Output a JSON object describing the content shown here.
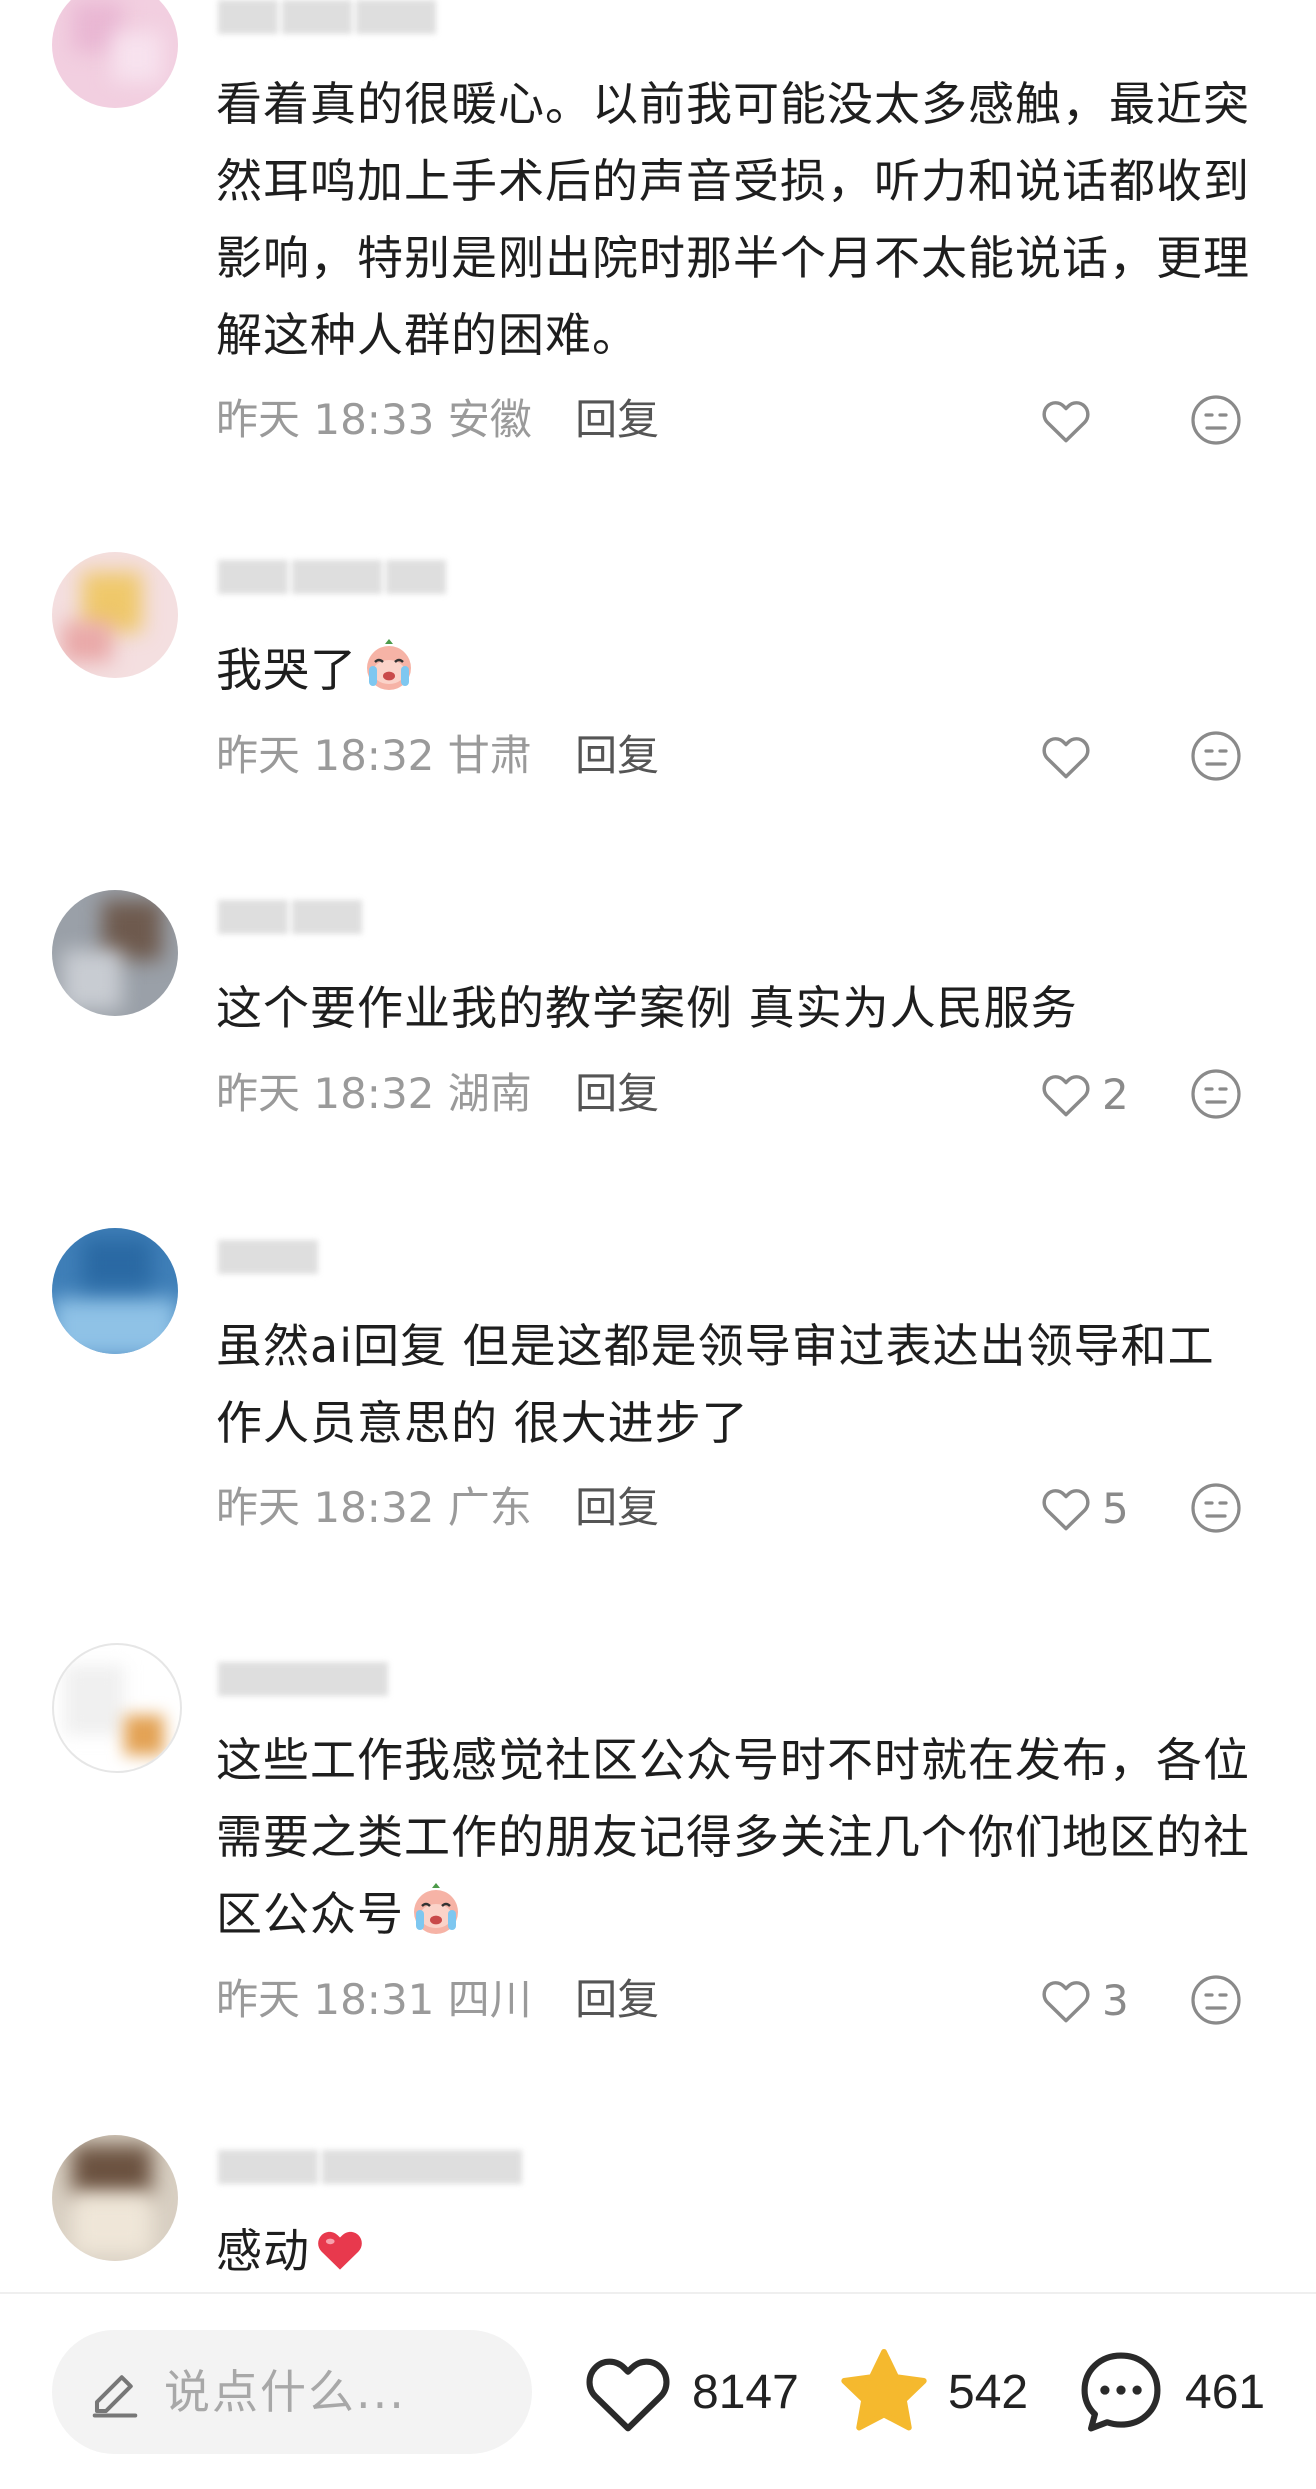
{
  "comments": [
    {
      "text": "看着真的很暖心。以前我可能没太多感触，最近突然耳鸣加上手术后的声音受损，听力和说话都收到影响，特别是刚出院时那半个月不太能说话，更理解这种人群的困难。",
      "time": "昨天 18:33",
      "location": "安徽",
      "reply": "回复",
      "likes": ""
    },
    {
      "text": "我哭了",
      "time": "昨天 18:32",
      "location": "甘肃",
      "reply": "回复",
      "likes": ""
    },
    {
      "text": "这个要作业我的教学案例 真实为人民服务",
      "time": "昨天 18:32",
      "location": "湖南",
      "reply": "回复",
      "likes": "2"
    },
    {
      "text": "虽然ai回复 但是这都是领导审过表达出领导和工作人员意思的 很大进步了",
      "time": "昨天 18:32",
      "location": "广东",
      "reply": "回复",
      "likes": "5"
    },
    {
      "text": "这些工作我感觉社区公众号时不时就在发布，各位需要之类工作的朋友记得多关注几个你们地区的社区公众号",
      "time": "昨天 18:31",
      "location": "四川",
      "reply": "回复",
      "likes": "3"
    },
    {
      "text": "感动",
      "time": "",
      "location": "",
      "reply": "",
      "likes": ""
    }
  ],
  "bottom_bar": {
    "input_placeholder": "说点什么...",
    "like_count": "8147",
    "collect_count": "542",
    "comment_count": "461"
  },
  "colors": {
    "text": "#1e1e1e",
    "meta": "#9a9a9a",
    "star": "#f5b92e",
    "heart_red": "#e8394d"
  },
  "icons": [
    "heart-outline-icon",
    "dislike-face-icon",
    "pen-icon",
    "star-icon",
    "comment-bubble-icon",
    "crying-emoji",
    "red-heart-emoji"
  ]
}
